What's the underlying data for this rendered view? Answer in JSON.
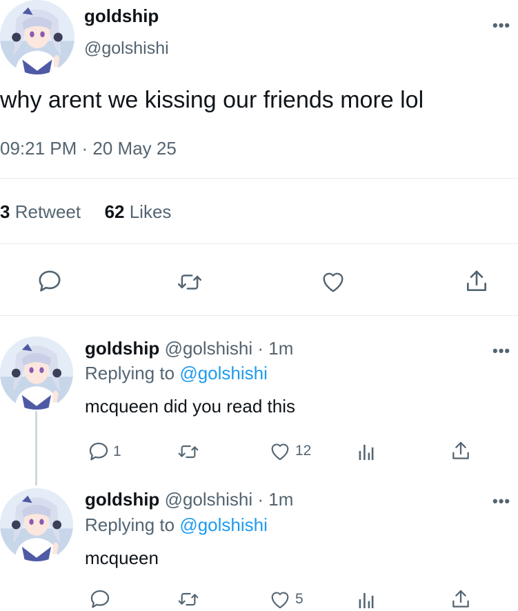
{
  "main_tweet": {
    "display_name": "goldship",
    "handle": "@golshishi",
    "text": "why arent we kissing our friends more lol",
    "timestamp": "09:21 PM · 20 May 25",
    "retweet_count": "3",
    "retweet_label": "Retweet",
    "like_count": "62",
    "like_label": "Likes",
    "more": "•••"
  },
  "replies": [
    {
      "display_name": "goldship",
      "handle_time": "@golshishi · 1m",
      "replying_prefix": "Replying to",
      "replying_to": "@golshishi",
      "text": "mcqueen did you read this",
      "reply_count": "1",
      "like_count": "12",
      "more": "•••"
    },
    {
      "display_name": "goldship",
      "handle_time": "@golshishi · 1m",
      "replying_prefix": "Replying to",
      "replying_to": "@golshishi",
      "text": "mcqueen",
      "reply_count": "",
      "like_count": "5",
      "more": "•••"
    }
  ],
  "icons": [
    "reply-icon",
    "retweet-icon",
    "like-icon",
    "share-icon",
    "analytics-icon",
    "more-icon"
  ],
  "colors": {
    "text": "#0f1419",
    "secondary": "#536471",
    "link": "#1d9bf0",
    "divider": "#e6e9eb"
  }
}
